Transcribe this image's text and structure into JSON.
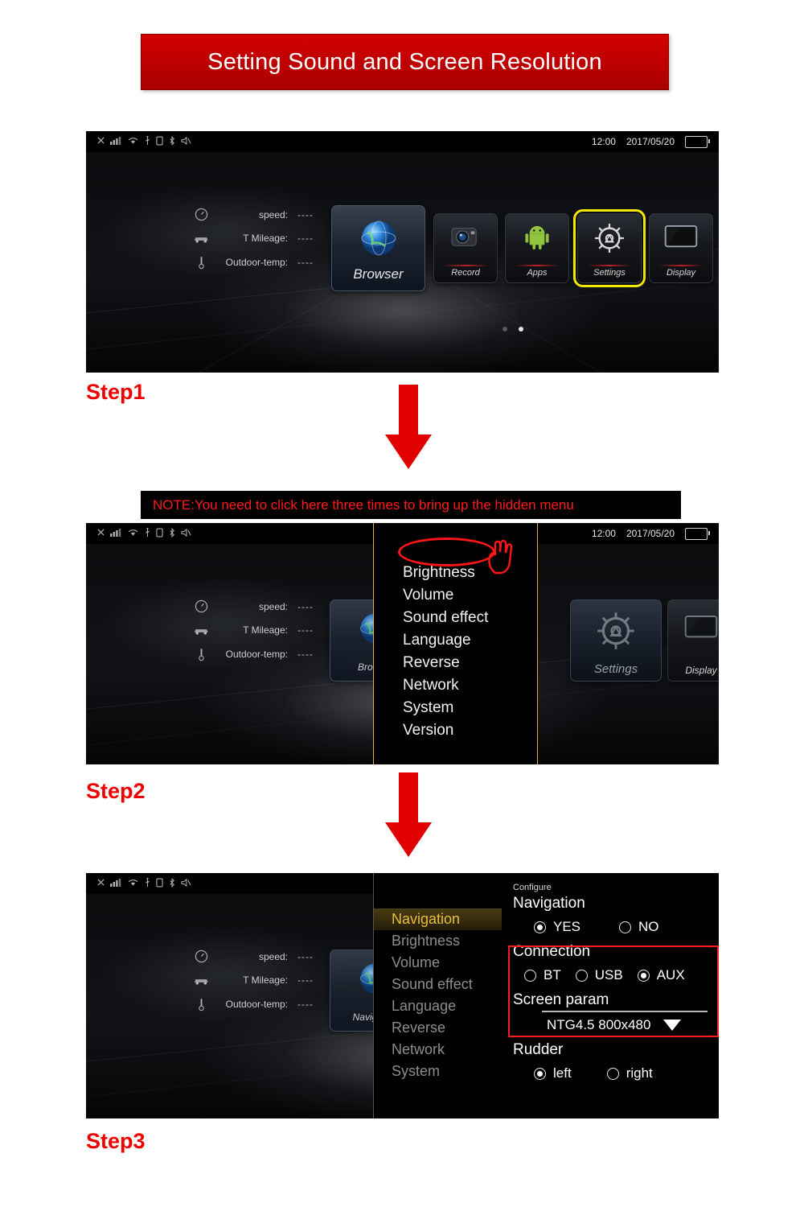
{
  "title": "Setting Sound and Screen Resolution",
  "note": "NOTE:You need to click here three times to bring up the hidden menu",
  "steps": {
    "step1": "Step1",
    "step2": "Step2",
    "step3": "Step3"
  },
  "statusbar": {
    "time": "12:00",
    "date": "2017/05/20",
    "icons": [
      "close-icon",
      "signal-icon",
      "wifi-icon",
      "usb-icon",
      "sim-icon",
      "bluetooth-icon",
      "mute-icon"
    ]
  },
  "dash": {
    "rows": [
      {
        "icon": "gauge-icon",
        "label": "speed:",
        "value": "----"
      },
      {
        "icon": "car-icon",
        "label": "T Mileage:",
        "value": "----"
      },
      {
        "icon": "thermometer-icon",
        "label": "Outdoor-temp:",
        "value": "----"
      }
    ]
  },
  "home_tiles": [
    {
      "label": "Browser",
      "icon": "globe-icon",
      "selected": false
    },
    {
      "label": "Record",
      "icon": "camera-icon",
      "selected": false
    },
    {
      "label": "Apps",
      "icon": "android-icon",
      "selected": false
    },
    {
      "label": "Settings",
      "icon": "gear-icon",
      "selected": true
    },
    {
      "label": "Display",
      "icon": "monitor-icon",
      "selected": false
    }
  ],
  "step2_menu": [
    {
      "label": "Brightness"
    },
    {
      "label": "Volume"
    },
    {
      "label": "Sound effect"
    },
    {
      "label": "Language"
    },
    {
      "label": "Reverse"
    },
    {
      "label": "Network"
    },
    {
      "label": "System"
    },
    {
      "label": "Version"
    }
  ],
  "step2_tiles": [
    {
      "label": "Browser",
      "icon": "globe-icon"
    },
    {
      "label": "Settings",
      "icon": "gear-icon"
    },
    {
      "label": "Display",
      "icon": "monitor-icon"
    }
  ],
  "step3_menu": [
    {
      "label": "Navigation",
      "highlight": true
    },
    {
      "label": "Brightness",
      "highlight": false
    },
    {
      "label": "Volume",
      "highlight": false
    },
    {
      "label": "Sound effect",
      "highlight": false
    },
    {
      "label": "Language",
      "highlight": false
    },
    {
      "label": "Reverse",
      "highlight": false
    },
    {
      "label": "Network",
      "highlight": false
    },
    {
      "label": "System",
      "highlight": false
    }
  ],
  "config": {
    "configure_label": "Configure",
    "navigation": {
      "title": "Navigation",
      "options": [
        {
          "label": "YES",
          "selected": true
        },
        {
          "label": "NO",
          "selected": false
        }
      ]
    },
    "connection": {
      "title": "Connection",
      "options": [
        {
          "label": "BT",
          "selected": false
        },
        {
          "label": "USB",
          "selected": false
        },
        {
          "label": "AUX",
          "selected": true
        }
      ]
    },
    "screen_param": {
      "title": "Screen param",
      "value": "NTG4.5  800x480",
      "caret": "chevron-down-icon"
    },
    "rudder": {
      "title": "Rudder",
      "options": [
        {
          "label": "left",
          "selected": true
        },
        {
          "label": "right",
          "selected": false
        }
      ]
    }
  },
  "colors": {
    "banner_red": "#c10000",
    "note_red": "#ff1a1a",
    "step_red": "#ee0000",
    "highlight_yellow": "#f2e800",
    "menu_gold": "#e8bf3e"
  }
}
